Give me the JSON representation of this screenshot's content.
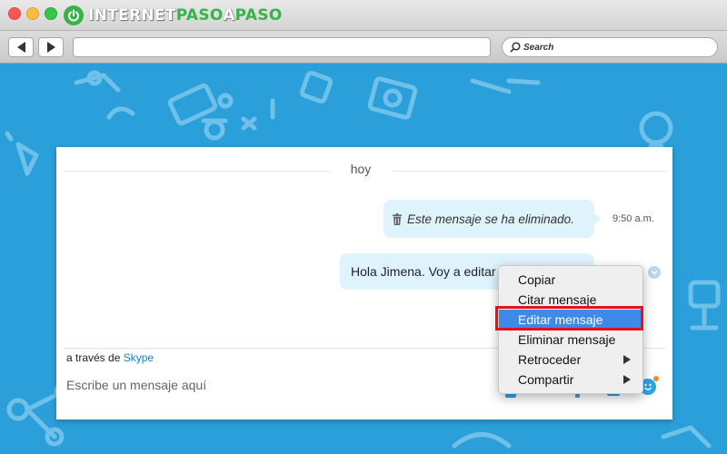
{
  "window": {
    "logo": {
      "part1": "INTERNET",
      "part2": "PASO",
      "part3": "A",
      "part4": "PASO"
    },
    "url": "",
    "search_placeholder": "Search"
  },
  "chat": {
    "day_label": "hoy",
    "messages": [
      {
        "text": "Este mensaje se ha eliminado.",
        "time": "9:50 a.m.",
        "deleted": true
      },
      {
        "text": "Hola Jimena. Voy a editar",
        "deleted": false
      }
    ],
    "via_prefix": "a través de",
    "via_link": "Skype",
    "compose_placeholder": "Escribe un mensaje aquí"
  },
  "context_menu": {
    "items": [
      {
        "label": "Copiar",
        "submenu": false
      },
      {
        "label": "Citar mensaje",
        "submenu": false
      },
      {
        "label": "Editar mensaje",
        "submenu": false,
        "selected": true
      },
      {
        "label": "Eliminar mensaje",
        "submenu": false
      },
      {
        "label": "Retroceder",
        "submenu": true
      },
      {
        "label": "Compartir",
        "submenu": true
      }
    ]
  },
  "colors": {
    "background": "#2b9fd9",
    "bubble": "#dff3fd",
    "selection": "#3f8ae8",
    "highlight": "#e1141c",
    "brand_green": "#37b34a"
  }
}
